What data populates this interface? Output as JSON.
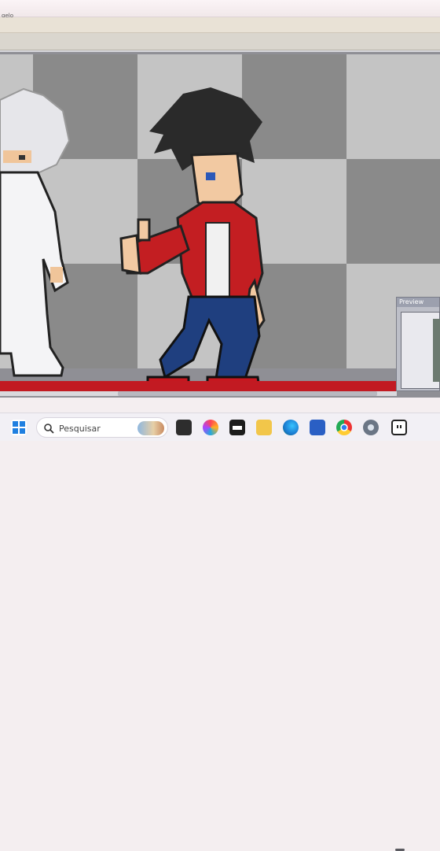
{
  "window": {
    "title": "gelo"
  },
  "preview": {
    "title": "Preview"
  },
  "taskbar": {
    "search_placeholder": "Pesquisar",
    "icons": [
      "windows-start-icon",
      "search-icon",
      "widgets-icon",
      "task-view-icon",
      "copilot-icon",
      "media-icon",
      "file-explorer-icon",
      "edge-icon",
      "store-icon",
      "chrome-icon",
      "settings-icon",
      "pixel-app-icon"
    ]
  },
  "colors": {
    "red_band": "#c21a22",
    "checker_dark": "#8a8a8a",
    "checker_light": "#c4c4c4"
  }
}
